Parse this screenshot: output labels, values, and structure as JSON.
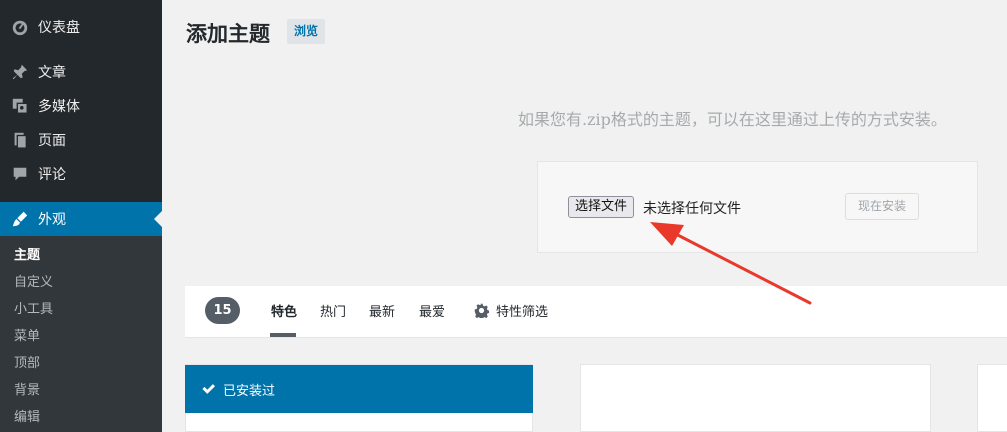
{
  "sidebar": {
    "items": [
      {
        "label": "仪表盘",
        "icon": "dashboard-icon"
      },
      {
        "label": "文章",
        "icon": "pin-icon"
      },
      {
        "label": "多媒体",
        "icon": "media-icon"
      },
      {
        "label": "页面",
        "icon": "page-icon"
      },
      {
        "label": "评论",
        "icon": "comment-icon"
      },
      {
        "label": "外观",
        "icon": "appearance-icon",
        "active": true
      }
    ],
    "submenu": [
      "主题",
      "自定义",
      "小工具",
      "菜单",
      "顶部",
      "背景",
      "编辑"
    ]
  },
  "header": {
    "title": "添加主题",
    "browse_label": "浏览"
  },
  "upload": {
    "description": "如果您有.zip格式的主题，可以在这里通过上传的方式安装。",
    "choose_file_label": "选择文件",
    "no_file_text": "未选择任何文件",
    "install_label": "现在安装"
  },
  "filter": {
    "count": "15",
    "tabs": [
      "特色",
      "热门",
      "最新",
      "最爱"
    ],
    "feature_filter_label": "特性筛选"
  },
  "themes": {
    "installed_label": "已安装过"
  },
  "colors": {
    "accent": "#0073aa",
    "annotation_arrow": "#e8392b"
  }
}
